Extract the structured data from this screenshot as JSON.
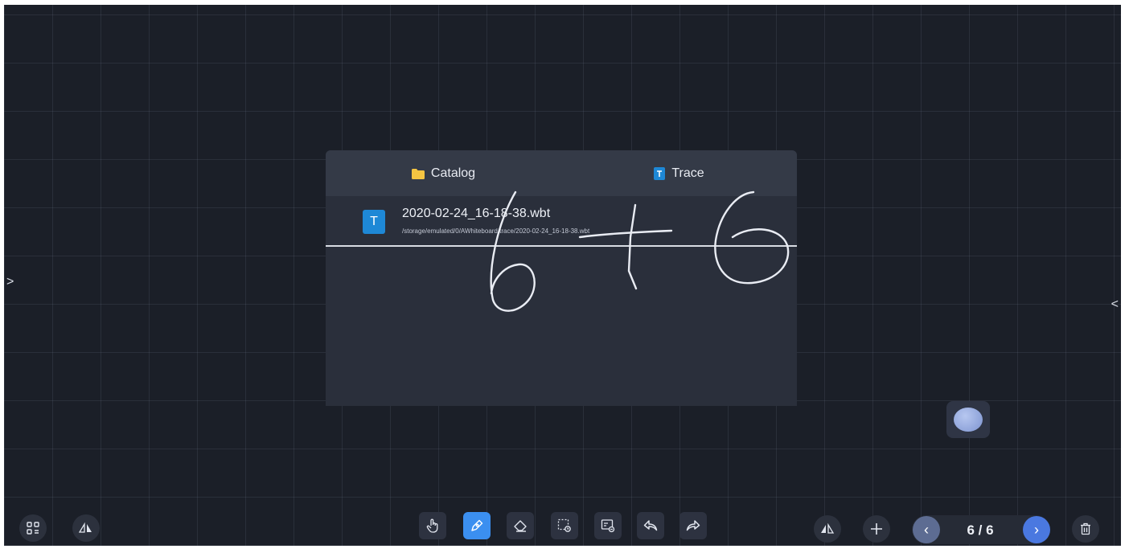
{
  "panel": {
    "tabs": [
      {
        "label": "Catalog",
        "icon": "folder-icon"
      },
      {
        "label": "Trace",
        "icon": "trace-file-icon"
      }
    ],
    "file": {
      "badge": "T",
      "name": "2020-02-24_16-18-38.wbt",
      "path": "/storage/emulated/0/AWhiteboard/trace/2020-02-24_16-18-38.wbt"
    }
  },
  "edges": {
    "left_arrow": ">",
    "right_arrow": "<"
  },
  "toolbar": {
    "left": [
      {
        "icon": "apps-icon"
      },
      {
        "icon": "flip-icon"
      }
    ],
    "center": [
      {
        "icon": "hand-pointer-icon"
      },
      {
        "icon": "pen-icon",
        "active": true
      },
      {
        "icon": "eraser-icon"
      },
      {
        "icon": "select-icon"
      },
      {
        "icon": "insert-image-icon"
      },
      {
        "icon": "undo-icon"
      },
      {
        "icon": "redo-icon"
      }
    ],
    "right": [
      {
        "icon": "mirror-icon"
      },
      {
        "icon": "plus-icon"
      }
    ]
  },
  "pager": {
    "prev": "‹",
    "next": "›",
    "text": "6 / 6"
  },
  "colors": {
    "board": "#1b1f28",
    "panel": "#2a2f3b",
    "panel_header": "#343a47",
    "accent": "#3b8ff0",
    "file_badge": "#1e88d6",
    "folder": "#f5c542"
  }
}
